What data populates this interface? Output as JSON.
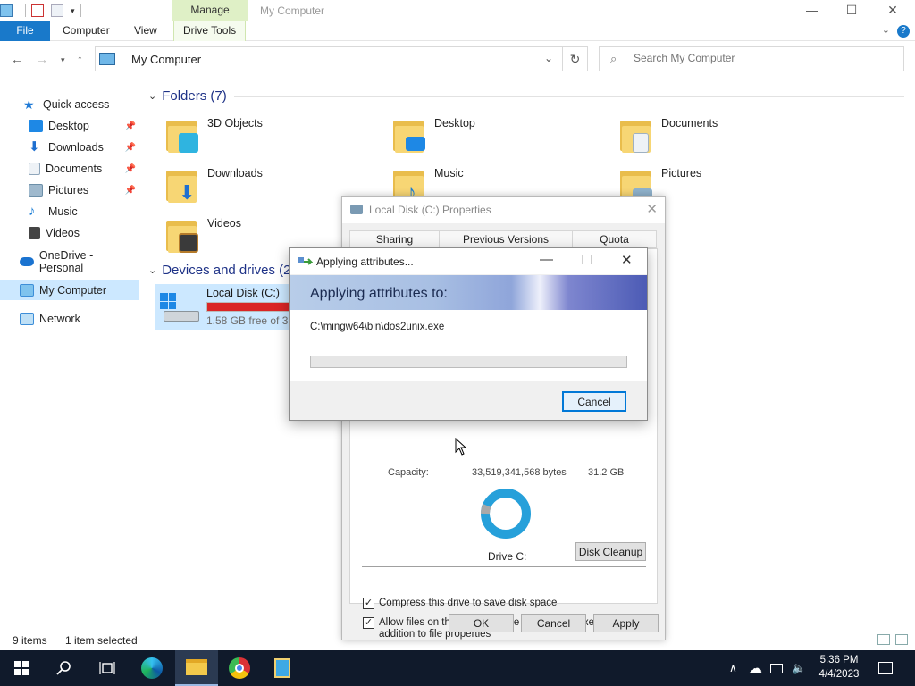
{
  "window": {
    "title": "My Computer",
    "context_tab": "Manage",
    "controls": {
      "minimize": "—",
      "maximize": "☐",
      "close": "✕"
    }
  },
  "ribbon": {
    "tabs": [
      "File",
      "Computer",
      "View",
      "Drive Tools"
    ]
  },
  "address": {
    "path": "My Computer",
    "search_placeholder": "Search My Computer"
  },
  "sidebar": {
    "items": [
      {
        "label": "Quick access",
        "icon": "star-icon",
        "color": "#1f7ad6"
      },
      {
        "label": "Desktop",
        "icon": "desktop-icon",
        "color": "#1e88e5",
        "pinned": true
      },
      {
        "label": "Downloads",
        "icon": "download-icon",
        "color": "#1e6fd0",
        "pinned": true
      },
      {
        "label": "Documents",
        "icon": "document-icon",
        "color": "#8fa6bb",
        "pinned": true
      },
      {
        "label": "Pictures",
        "icon": "pictures-icon",
        "color": "#6c8fa8",
        "pinned": true
      },
      {
        "label": "Music",
        "icon": "music-icon",
        "color": "#1e7fd6"
      },
      {
        "label": "Videos",
        "icon": "videos-icon",
        "color": "#555"
      },
      {
        "label": "OneDrive - Personal",
        "icon": "onedrive-icon",
        "color": "#1a73d0"
      },
      {
        "label": "My Computer",
        "icon": "computer-icon",
        "color": "#3d8ed8",
        "selected": true
      },
      {
        "label": "Network",
        "icon": "network-icon",
        "color": "#3d8ed8"
      }
    ]
  },
  "folders_section": {
    "header": "Folders (7)",
    "items": [
      {
        "label": "3D Objects",
        "badge_color": "#2fb4e0"
      },
      {
        "label": "Desktop",
        "badge_color": "#1e88e5"
      },
      {
        "label": "Documents",
        "badge_color": "#dfe7ef"
      },
      {
        "label": "Downloads",
        "badge_color": "#1e6fd0"
      },
      {
        "label": "Music",
        "badge_color": "#1e7fd6"
      },
      {
        "label": "Pictures",
        "badge_color": "#8fb2cc"
      },
      {
        "label": "Videos",
        "badge_color": "#444"
      }
    ]
  },
  "devices_section": {
    "header": "Devices and drives (2)",
    "drive": {
      "name": "Local Disk (C:)",
      "free_text": "1.58 GB free of 31",
      "used_fraction": 0.95
    }
  },
  "statusbar": {
    "items_count": "9 items",
    "selected": "1 item selected"
  },
  "properties_dialog": {
    "title": "Local Disk (C:) Properties",
    "tabs": [
      "Sharing",
      "Previous Versions",
      "Quota"
    ],
    "capacity_label": "Capacity:",
    "capacity_bytes": "33,519,341,568 bytes",
    "capacity_gb": "31.2 GB",
    "drive_label": "Drive C:",
    "disk_cleanup": "Disk Cleanup",
    "compress_label": "Compress this drive to save disk space",
    "compress_checked": true,
    "index_label_1": "Allow files on this drive to have contents indexed in",
    "index_label_2": "addition to file properties",
    "index_checked": true,
    "buttons": {
      "ok": "OK",
      "cancel": "Cancel",
      "apply": "Apply"
    }
  },
  "apply_dialog": {
    "title": "Applying attributes...",
    "banner": "Applying attributes to:",
    "path": "C:\\mingw64\\bin\\dos2unix.exe",
    "progress": 0,
    "cancel": "Cancel"
  },
  "taskbar": {
    "time": "5:36 PM",
    "date": "4/4/2023",
    "apps": [
      "start-icon",
      "search-icon",
      "task-view-icon",
      "edge-icon",
      "file-explorer-icon",
      "chrome-icon",
      "app-icon"
    ]
  }
}
